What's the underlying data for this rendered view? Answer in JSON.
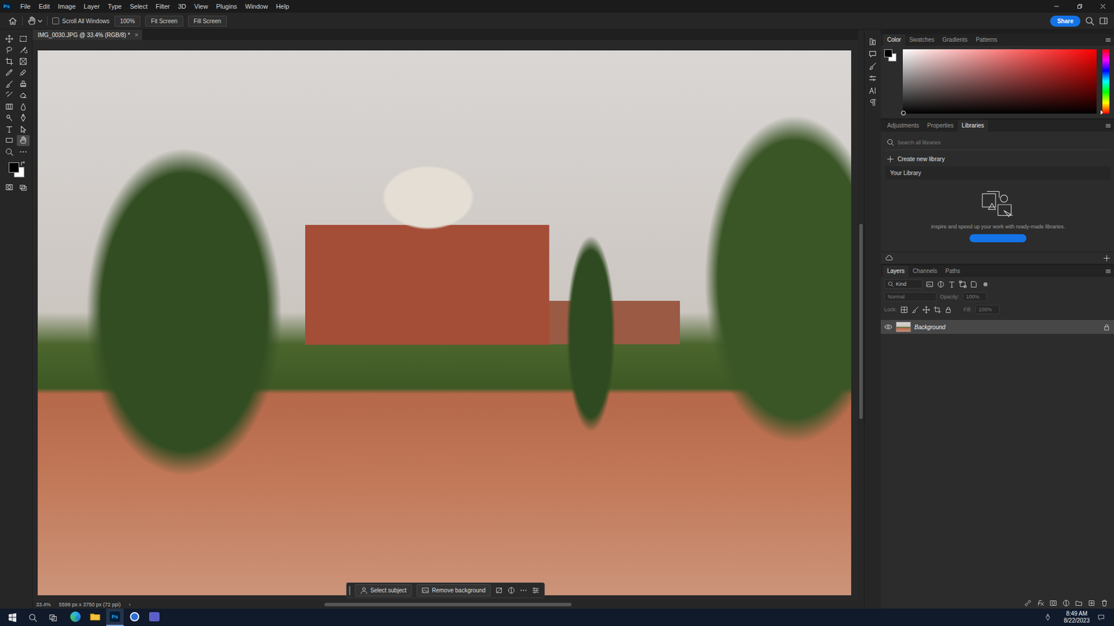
{
  "app": {
    "logo": "Ps"
  },
  "menu": [
    "File",
    "Edit",
    "Image",
    "Layer",
    "Type",
    "Select",
    "Filter",
    "3D",
    "View",
    "Plugins",
    "Window",
    "Help"
  ],
  "options_bar": {
    "scroll_all_windows": {
      "label": "Scroll All Windows",
      "checked": false
    },
    "buttons": [
      "100%",
      "Fit Screen",
      "Fill Screen"
    ],
    "share": "Share"
  },
  "toolbar": {
    "tools": [
      {
        "selected": false
      },
      {
        "selected": false
      },
      {
        "selected": false
      },
      {
        "selected": false
      },
      {
        "selected": false
      },
      {
        "selected": false
      },
      {
        "selected": false
      },
      {
        "selected": false
      },
      {
        "selected": false
      },
      {
        "selected": false
      },
      {
        "selected": false
      },
      {
        "selected": false
      },
      {
        "selected": false
      },
      {
        "selected": false
      },
      {
        "selected": false
      },
      {
        "selected": false
      },
      {
        "selected": false
      },
      {
        "selected": false
      },
      {
        "selected": false
      },
      {
        "selected": true
      },
      {
        "selected": false
      },
      {
        "selected": false
      },
      {
        "selected": false
      },
      {
        "selected": false
      }
    ]
  },
  "document_tab": {
    "title": "IMG_0030.JPG @ 33.4% (RGB/8) *",
    "close": "×"
  },
  "contextual_bar": {
    "buttons": [
      "Select subject",
      "Remove background"
    ]
  },
  "status_bar": {
    "zoom": "33.4%",
    "dimensions": "5599 px x 3750 px (72 ppi)",
    "arrow": "›"
  },
  "color_panel": {
    "tabs": [
      {
        "label": "Color",
        "selected": true
      },
      {
        "label": "Swatches",
        "selected": false
      },
      {
        "label": "Gradients",
        "selected": false
      },
      {
        "label": "Patterns",
        "selected": false
      }
    ]
  },
  "libraries_panel": {
    "tabs": [
      {
        "label": "Adjustments",
        "selected": false
      },
      {
        "label": "Properties",
        "selected": false
      },
      {
        "label": "Libraries",
        "selected": true
      }
    ],
    "search_placeholder": "Search all libraries",
    "create": "Create new library",
    "library": "Your Library",
    "hint": "Inspire and speed up your work with ready-made libraries."
  },
  "layers_panel": {
    "tabs": [
      {
        "label": "Layers",
        "selected": true
      },
      {
        "label": "Channels",
        "selected": false
      },
      {
        "label": "Paths",
        "selected": false
      }
    ],
    "filter": "Kind",
    "blend_mode": "Normal",
    "opacity_label": "Opacity:",
    "opacity": "100%",
    "lock_label": "Lock:",
    "fill_label": "Fill:",
    "fill": "100%",
    "options_disabled": true,
    "layers": [
      {
        "name": "Background",
        "visible": true,
        "locked": true,
        "selected": true
      }
    ]
  },
  "taskbar": {
    "apps": [
      {
        "kind": "edge",
        "active": false
      },
      {
        "kind": "explorer",
        "active": false
      },
      {
        "kind": "photoshop",
        "label": "Ps",
        "active": true
      },
      {
        "kind": "circle",
        "active": false
      },
      {
        "kind": "teams",
        "active": false
      }
    ],
    "time": "8:49 AM",
    "date": "8/22/2023"
  }
}
